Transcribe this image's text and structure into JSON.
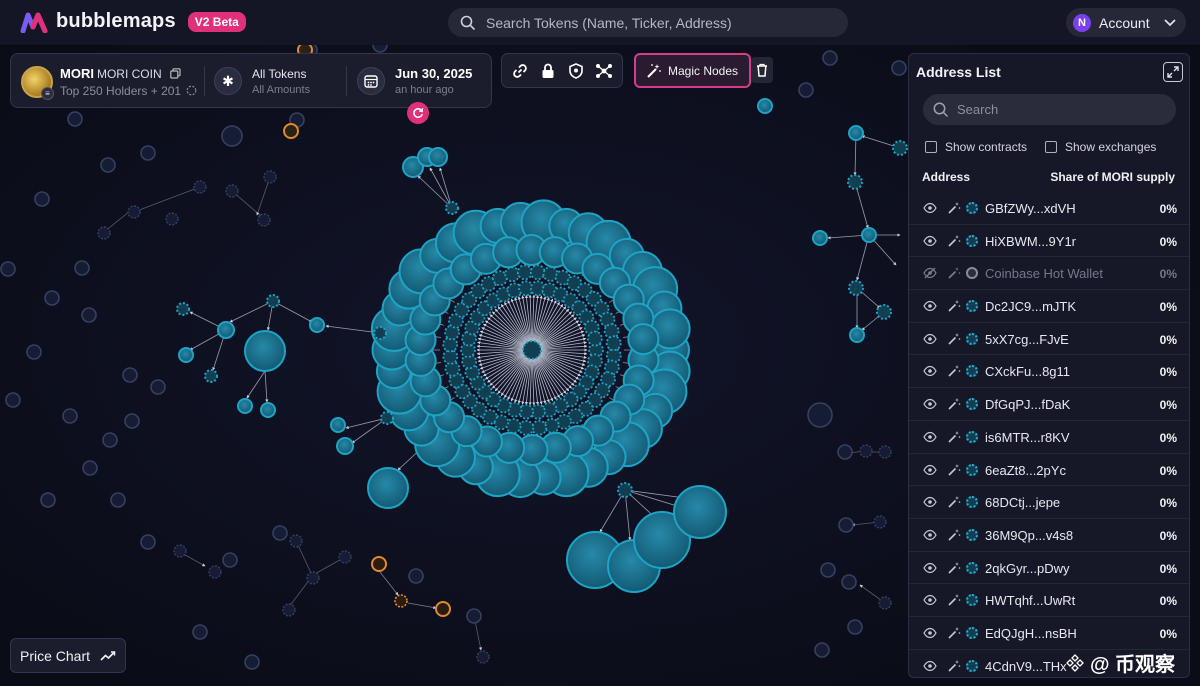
{
  "header": {
    "brand": "bubblemaps",
    "badge": "V2 Beta",
    "search_placeholder": "Search Tokens (Name, Ticker, Address)",
    "account_initial": "N",
    "account_label": "Account"
  },
  "token": {
    "ticker": "MORI",
    "name": "MORI COIN",
    "holders_text": "Top 250 Holders + 201",
    "tokens_filter": "All Tokens",
    "amounts_filter": "All Amounts",
    "date": "Jun 30, 2025",
    "date_sub": "an hour ago"
  },
  "toolbar": {
    "tools": [
      "link-icon",
      "lock-icon",
      "shield-icon",
      "network-icon"
    ],
    "magic_nodes_label": "Magic Nodes"
  },
  "address_panel": {
    "title": "Address List",
    "search_placeholder": "Search",
    "show_contracts": "Show contracts",
    "show_exchanges": "Show exchanges",
    "col_address": "Address",
    "col_share": "Share of MORI supply",
    "rows": [
      {
        "address": "GBfZWy...xdVH",
        "share": "0%"
      },
      {
        "address": "HiXBWM...9Y1r",
        "share": "0%"
      },
      {
        "address": "Coinbase Hot Wallet",
        "share": "0%",
        "dim": true
      },
      {
        "address": "Dc2JC9...mJTK",
        "share": "0%"
      },
      {
        "address": "5xX7cg...FJvE",
        "share": "0%"
      },
      {
        "address": "CXckFu...8g11",
        "share": "0%"
      },
      {
        "address": "DfGqPJ...fDaK",
        "share": "0%"
      },
      {
        "address": "is6MTR...r8KV",
        "share": "0%"
      },
      {
        "address": "6eaZt8...2pYc",
        "share": "0%"
      },
      {
        "address": "68DCtj...jepe",
        "share": "0%"
      },
      {
        "address": "36M9Qp...v4s8",
        "share": "0%"
      },
      {
        "address": "2qkGyr...pDwy",
        "share": "0%"
      },
      {
        "address": "HWTqhf...UwRt",
        "share": "0%"
      },
      {
        "address": "EdQJgH...nsBH",
        "share": "0%"
      },
      {
        "address": "4CdnV9...THx",
        "share": ""
      }
    ]
  },
  "footer": {
    "price_chart_label": "Price Chart",
    "watermark": "@ 币观察"
  },
  "colors": {
    "bubble": "#1fa3c4",
    "bubble_fill": "#1c6f8e",
    "accent": "#e0307a",
    "orange": "#e08a2a",
    "background": "#0b0d1a"
  }
}
